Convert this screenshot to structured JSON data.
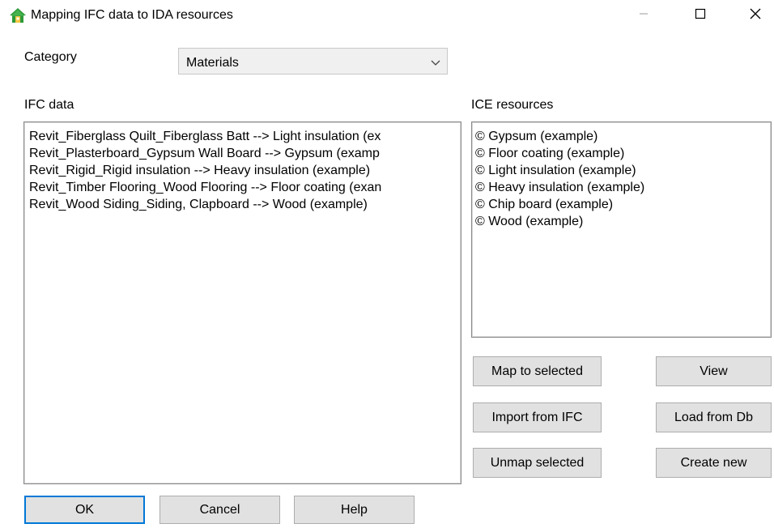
{
  "window": {
    "title": "Mapping IFC data to IDA resources"
  },
  "category": {
    "label": "Category",
    "selected": "Materials"
  },
  "ifc_data": {
    "label": "IFC data",
    "items": [
      "Revit_Fiberglass Quilt_Fiberglass Batt --> Light insulation (ex",
      "Revit_Plasterboard_Gypsum Wall Board --> Gypsum (examp",
      "Revit_Rigid_Rigid insulation --> Heavy insulation (example)",
      "Revit_Timber Flooring_Wood Flooring --> Floor coating (exan",
      "Revit_Wood Siding_Siding, Clapboard --> Wood (example)"
    ]
  },
  "ice_resources": {
    "label": "ICE resources",
    "items": [
      "© Gypsum (example)",
      "© Floor coating (example)",
      "© Light insulation (example)",
      "© Heavy insulation (example)",
      "© Chip board (example)",
      "© Wood (example)"
    ]
  },
  "actions": {
    "map_to_selected": "Map to selected",
    "view": "View",
    "import_from_ifc": "Import from IFC",
    "load_from_db": "Load from Db",
    "unmap_selected": "Unmap selected",
    "create_new": "Create new"
  },
  "footer": {
    "ok": "OK",
    "cancel": "Cancel",
    "help": "Help"
  },
  "icons": {
    "app": "home-icon",
    "minimize": "minimize-icon",
    "maximize": "maximize-icon",
    "close": "close-icon",
    "dropdown": "chevron-down-icon"
  },
  "colors": {
    "accent": "#0078d7",
    "app_icon_green": "#2e9a3a",
    "button_face": "#e1e1e1"
  }
}
